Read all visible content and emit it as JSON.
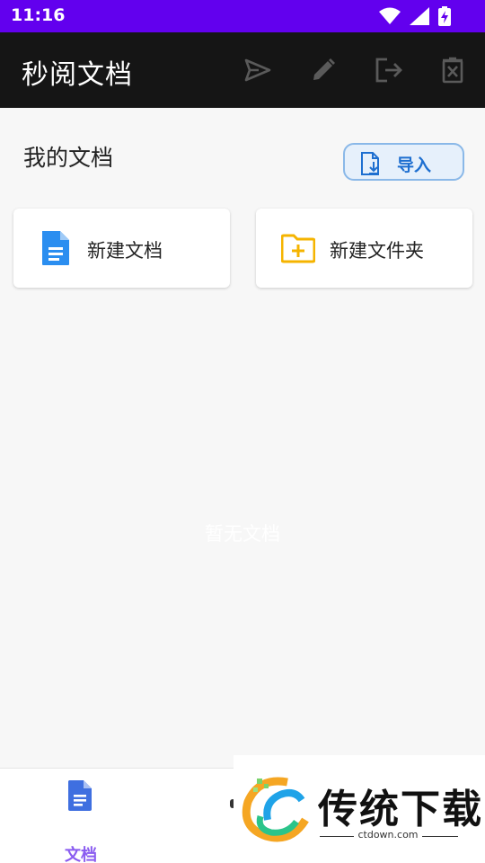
{
  "status_bar": {
    "time": "11:16",
    "icons": [
      "wifi-icon",
      "signal-icon",
      "battery-charging-icon"
    ]
  },
  "app_bar": {
    "title": "秒阅文档",
    "actions": [
      "send-icon",
      "edit-icon",
      "logout-icon",
      "delete-icon"
    ]
  },
  "main": {
    "section_title": "我的文档",
    "import_label": "导入",
    "cards": [
      {
        "label": "新建文档",
        "icon": "document-icon",
        "color": "#2b8ef0"
      },
      {
        "label": "新建文件夹",
        "icon": "folder-add-icon",
        "color": "#f5b400"
      }
    ],
    "empty_text": "暂无文档"
  },
  "bottom_nav": {
    "items": [
      {
        "label": "文档",
        "icon": "document-icon",
        "active": true
      }
    ]
  },
  "watermark": {
    "title": "传统下载",
    "site": "ctdown.com"
  },
  "colors": {
    "status_bar": "#6200ee",
    "app_bar": "#151515",
    "accent": "#1e6fd0",
    "nav_active": "#8a5cf0"
  }
}
